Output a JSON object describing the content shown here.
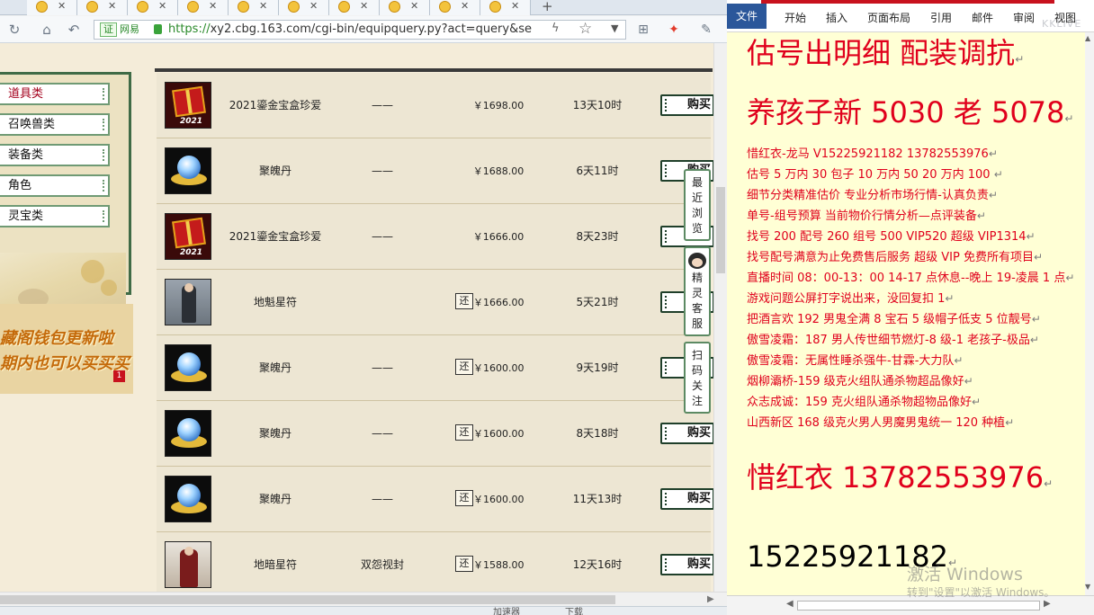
{
  "browser": {
    "tab_count": 10,
    "address": {
      "cert_label": "证",
      "site_label": "网易",
      "url_protocol": "https://",
      "url_rest": "xy2.cbg.163.com/cgi-bin/equipquery.py?act=query&se"
    },
    "icons": {
      "refresh": "↻",
      "home": "⌂",
      "undo": "↶",
      "bolt": "ϟ",
      "star": "☆",
      "dropdown": "▼",
      "grid": "⊞",
      "game": "✦",
      "wrench": "✎",
      "tab_close": "✕",
      "new_tab": "+"
    },
    "status": {
      "left": "加速器",
      "right": "下载"
    }
  },
  "page": {
    "categories": [
      {
        "label": "道具类",
        "active": true
      },
      {
        "label": "召唤兽类",
        "active": false
      },
      {
        "label": "装备类",
        "active": false
      },
      {
        "label": "角色",
        "active": false
      },
      {
        "label": "灵宝类",
        "active": false
      }
    ],
    "promo": {
      "line1": "藏阁钱包更新啦",
      "line2": "期内也可以买买买",
      "badge": "1"
    },
    "rows": [
      {
        "thumb": "gift",
        "thumb_label": "2021",
        "name": "2021鎏金宝盒珍爱",
        "attr": "——",
        "haggle": "",
        "price": "￥1698.00",
        "time": "13天10时",
        "buy": "购买"
      },
      {
        "thumb": "orb",
        "thumb_label": "",
        "name": "聚魄丹",
        "attr": "——",
        "haggle": "",
        "price": "￥1688.00",
        "time": "6天11时",
        "buy": "购买"
      },
      {
        "thumb": "gift",
        "thumb_label": "2021",
        "name": "2021鎏金宝盒珍爱",
        "attr": "——",
        "haggle": "",
        "price": "￥1666.00",
        "time": "8天23时",
        "buy": "购买"
      },
      {
        "thumb": "man",
        "thumb_label": "",
        "name": "地魁星符",
        "attr": "",
        "haggle": "还",
        "price": "￥1666.00",
        "time": "5天21时",
        "buy": "购买"
      },
      {
        "thumb": "orb",
        "thumb_label": "",
        "name": "聚魄丹",
        "attr": "——",
        "haggle": "还",
        "price": "￥1600.00",
        "time": "9天19时",
        "buy": "购买"
      },
      {
        "thumb": "orb",
        "thumb_label": "",
        "name": "聚魄丹",
        "attr": "——",
        "haggle": "还",
        "price": "￥1600.00",
        "time": "8天18时",
        "buy": "购买"
      },
      {
        "thumb": "orb",
        "thumb_label": "",
        "name": "聚魄丹",
        "attr": "——",
        "haggle": "还",
        "price": "￥1600.00",
        "time": "11天13时",
        "buy": "购买"
      },
      {
        "thumb": "man2",
        "thumb_label": "",
        "name": "地暗星符",
        "attr": "双怨视封",
        "haggle": "还",
        "price": "￥1588.00",
        "time": "12天16时",
        "buy": "购买"
      }
    ],
    "side_tabs": [
      {
        "label": "最近浏览",
        "has_avatar": false
      },
      {
        "label": "精灵客服",
        "has_avatar": true
      },
      {
        "label": "扫码关注",
        "has_avatar": false
      }
    ]
  },
  "word": {
    "ribbon_tabs": [
      "文件",
      "开始",
      "插入",
      "页面布局",
      "引用",
      "邮件",
      "审阅",
      "视图"
    ],
    "logo_text": "KKLIVE",
    "mark": "↵",
    "lines": [
      {
        "text": "估号出明细 配装调抗",
        "size": "big",
        "color": "red"
      },
      {
        "text": "养孩子新 5030 老 5078",
        "size": "big",
        "color": "red"
      },
      {
        "text": "惜红衣-龙马 V15225921182    13782553976",
        "size": "sm",
        "color": "red"
      },
      {
        "text": "估号 5 万内 30 包子  10 万内 50  20 万内 100  ",
        "size": "sm",
        "color": "red"
      },
      {
        "text": "细节分类精准估价  专业分析市场行情-认真负责",
        "size": "sm",
        "color": "red"
      },
      {
        "text": "单号-组号预算   当前物价行情分析—点评装备",
        "size": "sm",
        "color": "red"
      },
      {
        "text": "找号 200    配号 260    组号 500  VIP520    超级 VIP1314",
        "size": "sm",
        "color": "red"
      },
      {
        "text": "找号配号满意为止免费售后服务   超级 VIP 免费所有项目",
        "size": "sm",
        "color": "red"
      },
      {
        "text": "直播时间 08：00-13：00  14-17 点休息--晚上 19-凌晨 1 点",
        "size": "sm",
        "color": "red"
      },
      {
        "text": "游戏问题公屏打字说出来，没回复扣 1",
        "size": "sm",
        "color": "red"
      },
      {
        "text": "把酒言欢 192 男鬼全满 8 宝石 5 级帽子低支 5 位靓号",
        "size": "sm",
        "color": "red"
      },
      {
        "text": "傲雪凌霜：187 男人传世细节燃灯-8 级-1 老孩子-极品",
        "size": "sm",
        "color": "red"
      },
      {
        "text": "傲雪凌霜：无属性睡杀强牛-甘霖-大力队",
        "size": "sm",
        "color": "red"
      },
      {
        "text": "烟柳灞桥-159 级克火组队通杀物超品像好",
        "size": "sm",
        "color": "red"
      },
      {
        "text": "众志成诚：159 克火组队通杀物超物品像好",
        "size": "sm",
        "color": "red"
      },
      {
        "text": "山西新区 168 级克火男人男魔男鬼统一 120 种植",
        "size": "sm",
        "color": "red"
      },
      {
        "text": "惜红衣 13782553976",
        "size": "big",
        "color": "red"
      },
      {
        "text": "15225921182",
        "size": "big",
        "color": "black"
      }
    ],
    "watermark_line1": "激活 Windows",
    "watermark_line2": "转到\"设置\"以激活 Windows。"
  },
  "colors": {
    "red_text": "#e0001c",
    "doc_background": "#ffffd5",
    "menu_border": "#3f6b46"
  }
}
